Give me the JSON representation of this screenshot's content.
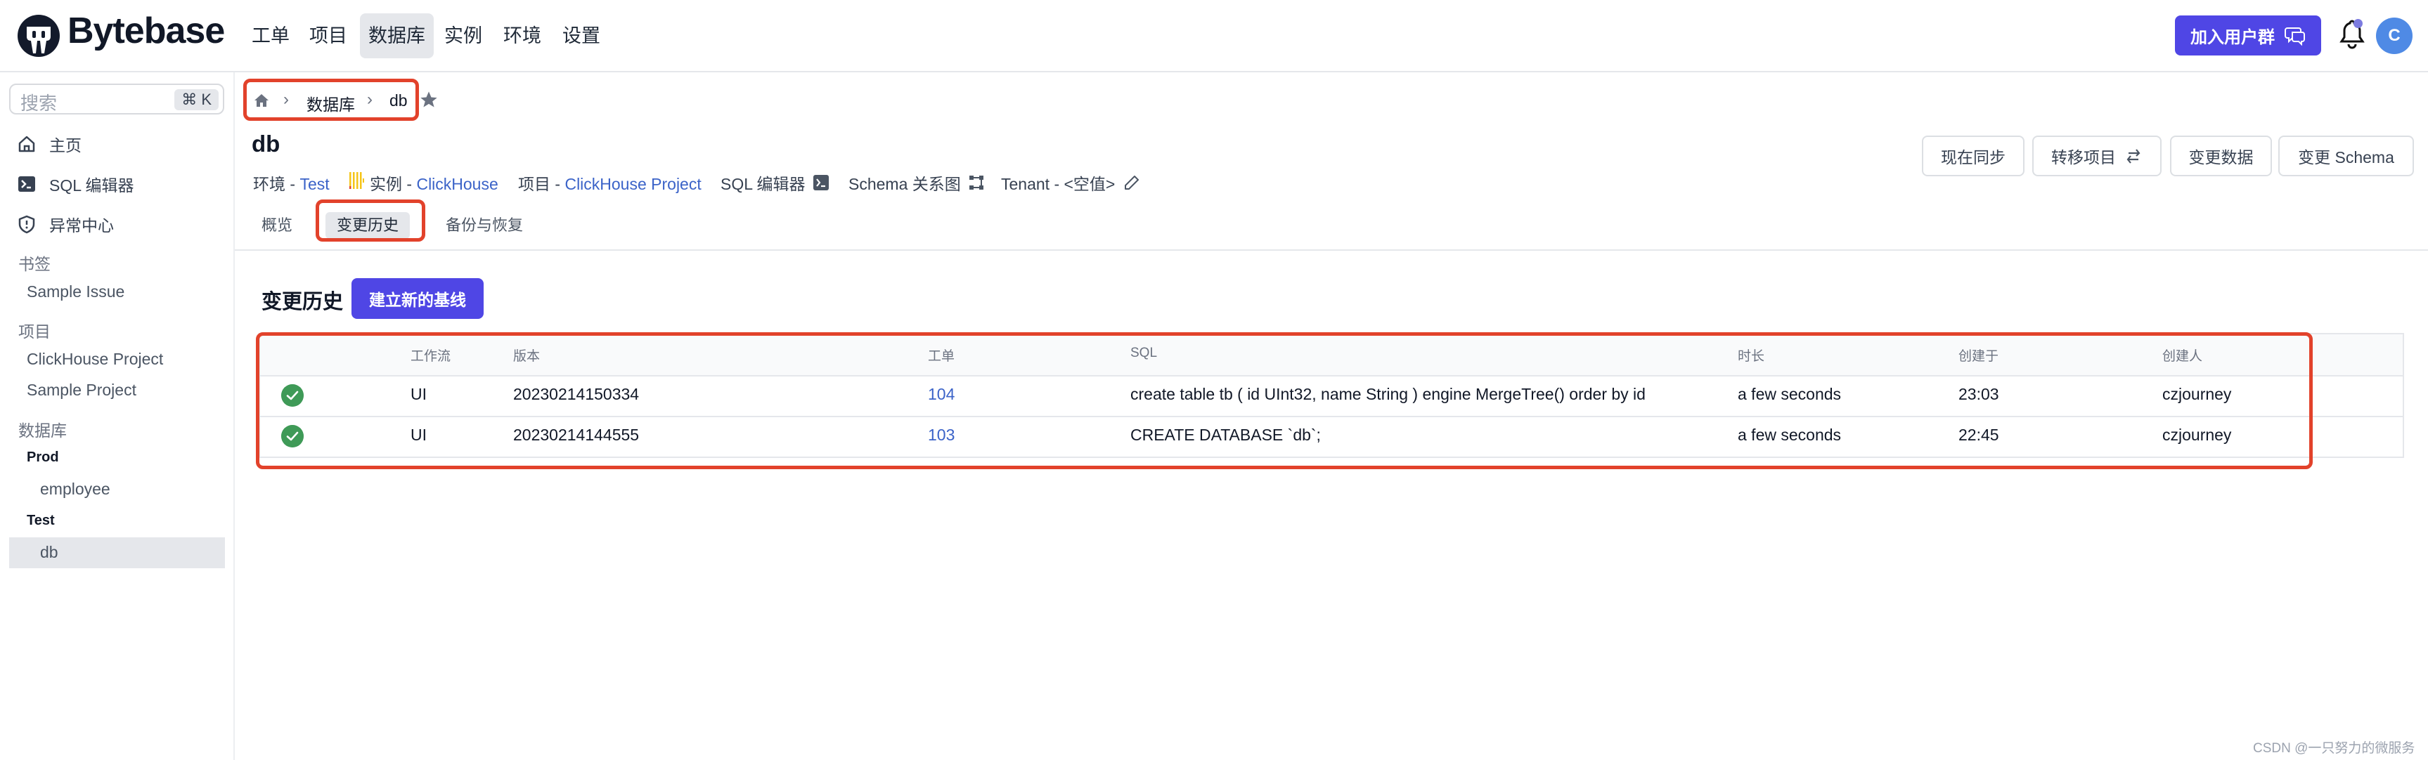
{
  "topnav": {
    "logo_text": "Bytebase",
    "items": [
      {
        "label": "工单",
        "active": false
      },
      {
        "label": "项目",
        "active": false
      },
      {
        "label": "数据库",
        "active": true
      },
      {
        "label": "实例",
        "active": false
      },
      {
        "label": "环境",
        "active": false
      },
      {
        "label": "设置",
        "active": false
      }
    ],
    "join_button": "加入用户群",
    "avatar_initial": "C",
    "accent_color": "#4f46e5"
  },
  "sidebar": {
    "search_placeholder": "搜索",
    "search_shortcut": "⌘ K",
    "main_items": [
      {
        "label": "主页",
        "icon": "home-icon"
      },
      {
        "label": "SQL 编辑器",
        "icon": "terminal-icon"
      },
      {
        "label": "异常中心",
        "icon": "shield-alert-icon"
      }
    ],
    "bookmarks_heading": "书签",
    "bookmarks": [
      "Sample Issue"
    ],
    "projects_heading": "项目",
    "projects": [
      "ClickHouse Project",
      "Sample Project"
    ],
    "databases_heading": "数据库",
    "environments": [
      {
        "name": "Prod",
        "databases": [
          "employee"
        ]
      },
      {
        "name": "Test",
        "databases": [
          "db"
        ]
      }
    ],
    "selected_database": "db"
  },
  "breadcrumb": {
    "home_icon": "home-icon",
    "items": [
      "数据库",
      "db"
    ],
    "star_icon": "star-icon"
  },
  "header": {
    "title": "db",
    "env_label": "环境 - ",
    "env_value": "Test",
    "instance_label": "实例 - ",
    "instance_value": "ClickHouse",
    "project_label": "项目 - ",
    "project_value": "ClickHouse Project",
    "sql_editor_label": "SQL 编辑器",
    "schema_diagram_label": "Schema 关系图",
    "tenant_label": "Tenant - <空值>"
  },
  "actions": {
    "sync_now": "现在同步",
    "transfer_project": "转移项目",
    "alter_data": "变更数据",
    "alter_schema": "变更 Schema"
  },
  "tabs": [
    {
      "label": "概览",
      "active": false
    },
    {
      "label": "变更历史",
      "active": true
    },
    {
      "label": "备份与恢复",
      "active": false
    }
  ],
  "history": {
    "title": "变更历史",
    "baseline_button": "建立新的基线",
    "columns": [
      "",
      "工作流",
      "版本",
      "工单",
      "SQL",
      "时长",
      "创建于",
      "创建人"
    ],
    "rows": [
      {
        "status": "done",
        "workflow": "UI",
        "version": "20230214150334",
        "issue": "104",
        "sql": "create table tb ( id UInt32, name String ) engine MergeTree() order by id",
        "duration": "a few seconds",
        "created_at": "23:03",
        "creator": "czjourney"
      },
      {
        "status": "done",
        "workflow": "UI",
        "version": "20230214144555",
        "issue": "103",
        "sql": "CREATE DATABASE `db`;",
        "duration": "a few seconds",
        "created_at": "22:45",
        "creator": "czjourney"
      }
    ]
  },
  "watermark": "CSDN @一只努力的微服务",
  "colors": {
    "link": "#3b63c8",
    "success": "#3f9a57",
    "highlight_box": "#e2422b"
  }
}
